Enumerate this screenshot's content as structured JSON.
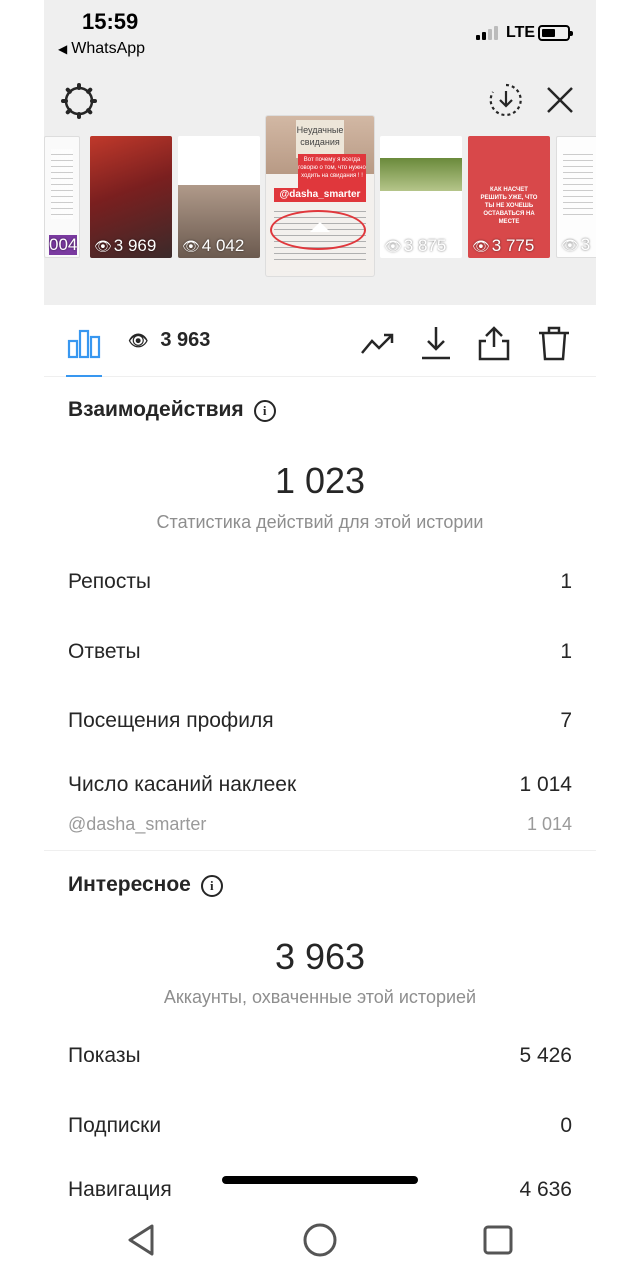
{
  "status_bar": {
    "time": "15:59",
    "back_app": "WhatsApp",
    "network": "LTE"
  },
  "carousel": {
    "thumbs": [
      {
        "views": "004"
      },
      {
        "views": "3 969"
      },
      {
        "views": "4 042"
      },
      {
        "views": "3 963",
        "selected": true,
        "tag": "@dasha_smarter",
        "headline": "Неудачные свидания",
        "banner": "Вот почему я всегда говорю о том, что нужно ходить на свидания ! !"
      },
      {
        "views": "3 875"
      },
      {
        "views": "3 775",
        "caption": "КАК НАСЧЕТ РЕШИТЬ УЖЕ, ЧТО ТЫ НЕ ХОЧЕШЬ ОСТАВАТЬСЯ НА МЕСТЕ"
      },
      {
        "views": "3"
      }
    ]
  },
  "toolbar": {
    "views": "3 963"
  },
  "interactions": {
    "title": "Взаимодействия",
    "total": "1 023",
    "subtitle": "Статистика действий для этой истории",
    "rows": [
      {
        "label": "Репосты",
        "value": "1"
      },
      {
        "label": "Ответы",
        "value": "1"
      },
      {
        "label": "Посещения профиля",
        "value": "7"
      },
      {
        "label": "Число касаний наклеек",
        "value": "1 014"
      }
    ],
    "sticker": {
      "label": "@dasha_smarter",
      "value": "1 014"
    }
  },
  "discovery": {
    "title": "Интересное",
    "total": "3 963",
    "subtitle": "Аккаунты, охваченные этой историей",
    "rows": [
      {
        "label": "Показы",
        "value": "5 426"
      },
      {
        "label": "Подписки",
        "value": "0"
      },
      {
        "label": "Навигация",
        "value": "4 636"
      }
    ]
  },
  "colors": {
    "accent_blue": "#3897f0",
    "text": "#262626",
    "muted": "#8e8e8e",
    "header_bg": "#efefef",
    "story_red": "#e0373c"
  },
  "icons": [
    "gear-icon",
    "download-circle-icon",
    "close-icon",
    "bar-chart-icon",
    "eye-icon",
    "trend-icon",
    "download-icon",
    "share-icon",
    "trash-icon",
    "info-icon",
    "back-triangle-icon",
    "home-circle-icon",
    "recents-square-icon"
  ]
}
